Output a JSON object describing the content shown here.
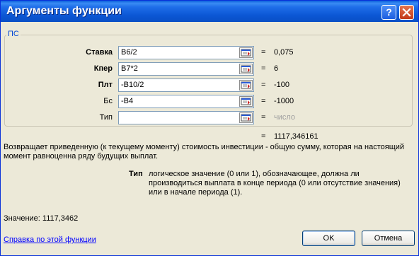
{
  "window": {
    "title": "Аргументы функции",
    "help_glyph": "?"
  },
  "function_group": {
    "name": "ПС",
    "args": [
      {
        "label": "Ставка",
        "bold": true,
        "value": "B6/2",
        "result": "0,075"
      },
      {
        "label": "Кпер",
        "bold": true,
        "value": "B7*2",
        "result": "6"
      },
      {
        "label": "Плт",
        "bold": true,
        "value": "-B10/2",
        "result": "-100"
      },
      {
        "label": "Бс",
        "bold": false,
        "value": "-B4",
        "result": "-1000"
      },
      {
        "label": "Тип",
        "bold": false,
        "value": "",
        "result": "число"
      }
    ],
    "equals": "="
  },
  "total_result": "1117,346161",
  "description": "Возвращает приведенную (к текущему моменту) стоимость инвестиции - общую сумму, которая на настоящий момент равноценна ряду будущих выплат.",
  "argument_help": {
    "name": "Тип",
    "text": "логическое значение (0 или 1), обозначающее, должна ли производиться выплата в конце периода (0 или отсутствие значения) или в начале периода (1)."
  },
  "value_line": "Значение:  1117,3462",
  "help_link": "Справка по этой функции",
  "buttons": {
    "ok": "OK",
    "cancel": "Отмена"
  },
  "colors": {
    "title_bar": "#0b56d4",
    "link": "#0000ff",
    "group_label": "#0046d5"
  },
  "icons": {
    "collapse": "collapse-dialog-icon",
    "close": "close-icon",
    "help": "help-icon"
  }
}
